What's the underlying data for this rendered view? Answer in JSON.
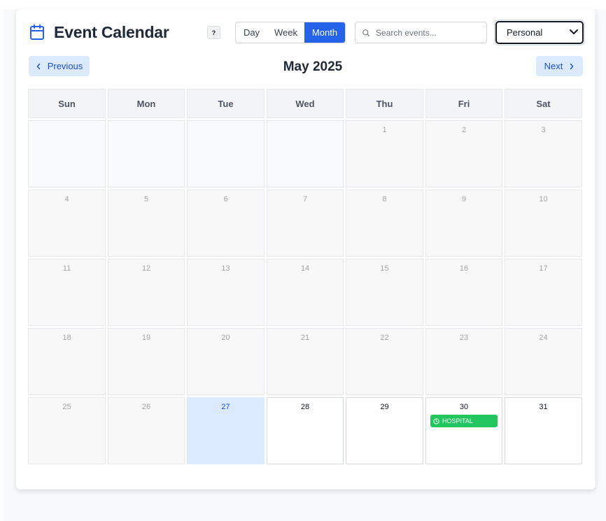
{
  "header": {
    "title": "Event Calendar",
    "help_label": "?",
    "views": [
      "Day",
      "Week",
      "Month"
    ],
    "active_view": "Month",
    "search": {
      "placeholder": "Search events...",
      "value": ""
    },
    "calendar_select": {
      "value": "Personal"
    }
  },
  "navigation": {
    "prev_label": "Previous",
    "next_label": "Next",
    "month_label": "May 2025"
  },
  "calendar": {
    "weekdays": [
      "Sun",
      "Mon",
      "Tue",
      "Wed",
      "Thu",
      "Fri",
      "Sat"
    ],
    "leading_blank_days": 4,
    "days_in_month": 31,
    "today": 27,
    "events": [
      {
        "day": 30,
        "label": "HOSPITAL",
        "color": "#22c55e",
        "icon": "clock-icon"
      }
    ]
  },
  "colors": {
    "accent": "#2563eb",
    "today_bg": "#dbeafe",
    "event_green": "#22c55e"
  }
}
